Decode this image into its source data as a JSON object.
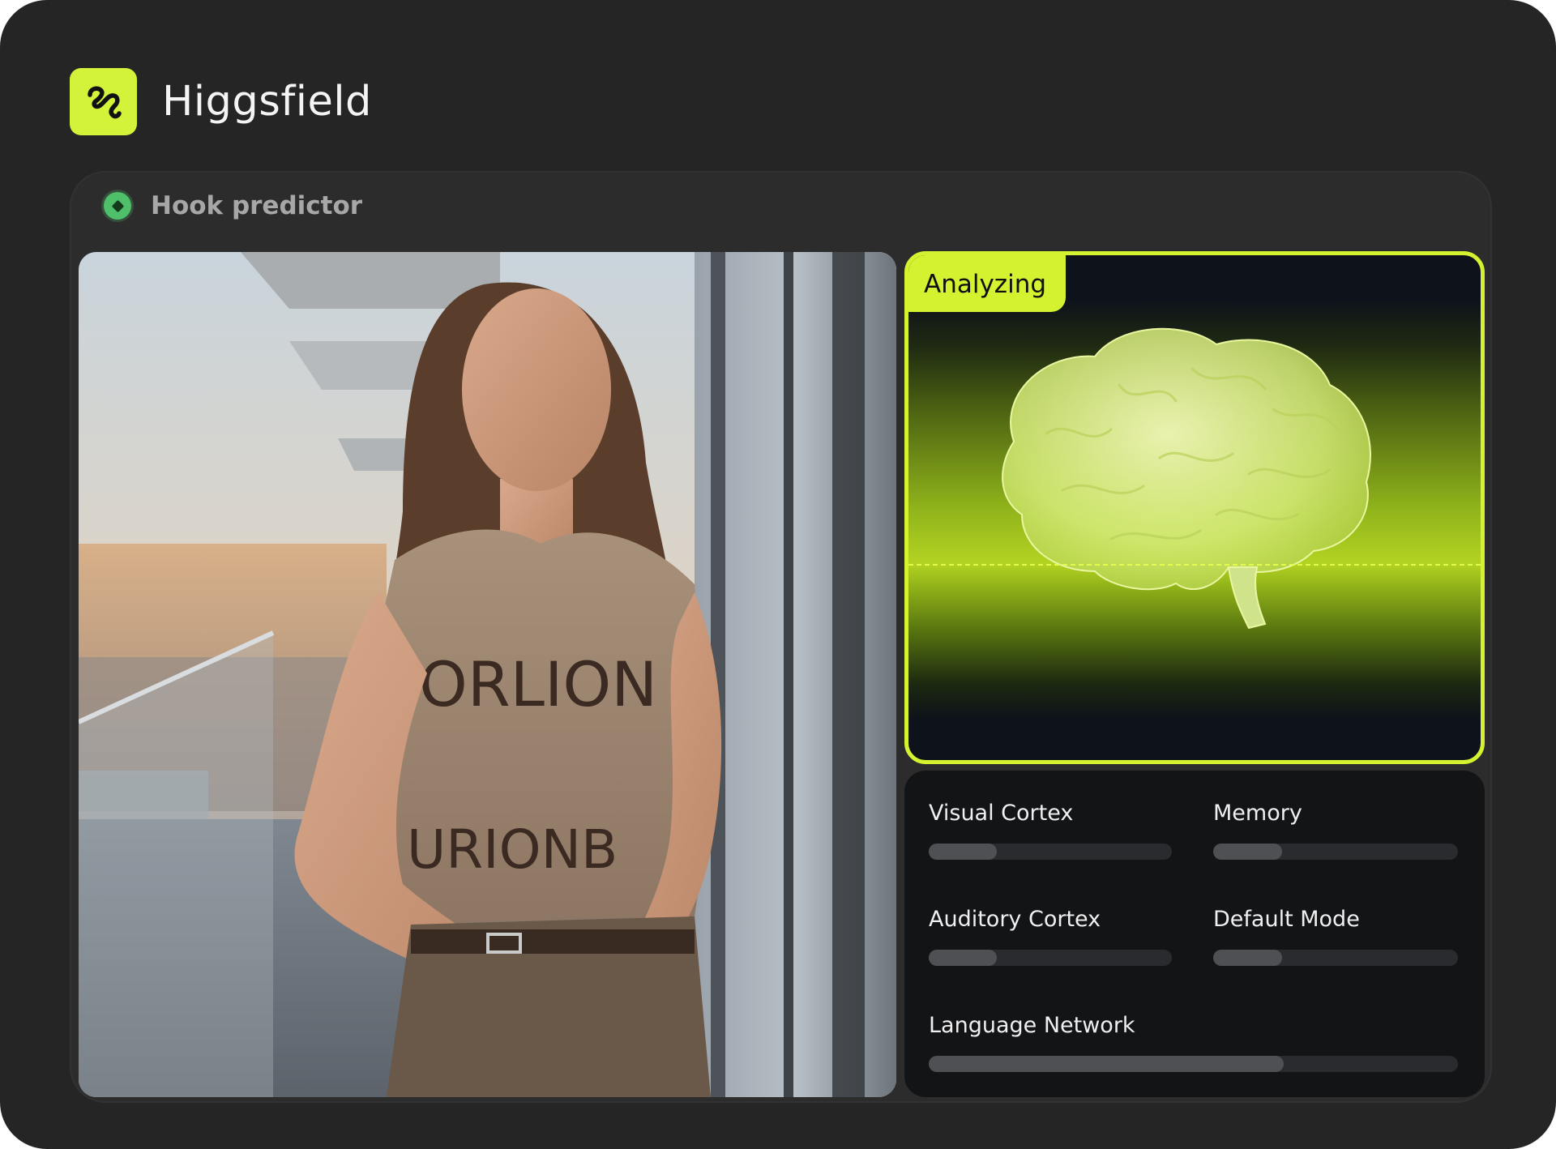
{
  "app": {
    "name": "Higgsfield",
    "brand_color": "#d2f33a"
  },
  "panel": {
    "title": "Hook predictor",
    "status_color": "#4fbf6a"
  },
  "analysis": {
    "tag": "Analyzing",
    "accent": "#d4f230"
  },
  "metrics": [
    {
      "label": "Visual Cortex",
      "fill_fraction": 0.28
    },
    {
      "label": "Memory",
      "fill_fraction": 0.28
    },
    {
      "label": "Auditory Cortex",
      "fill_fraction": 0.28
    },
    {
      "label": "Default Mode",
      "fill_fraction": 0.28
    },
    {
      "label": "Language Network",
      "fill_fraction": 0.67
    }
  ]
}
